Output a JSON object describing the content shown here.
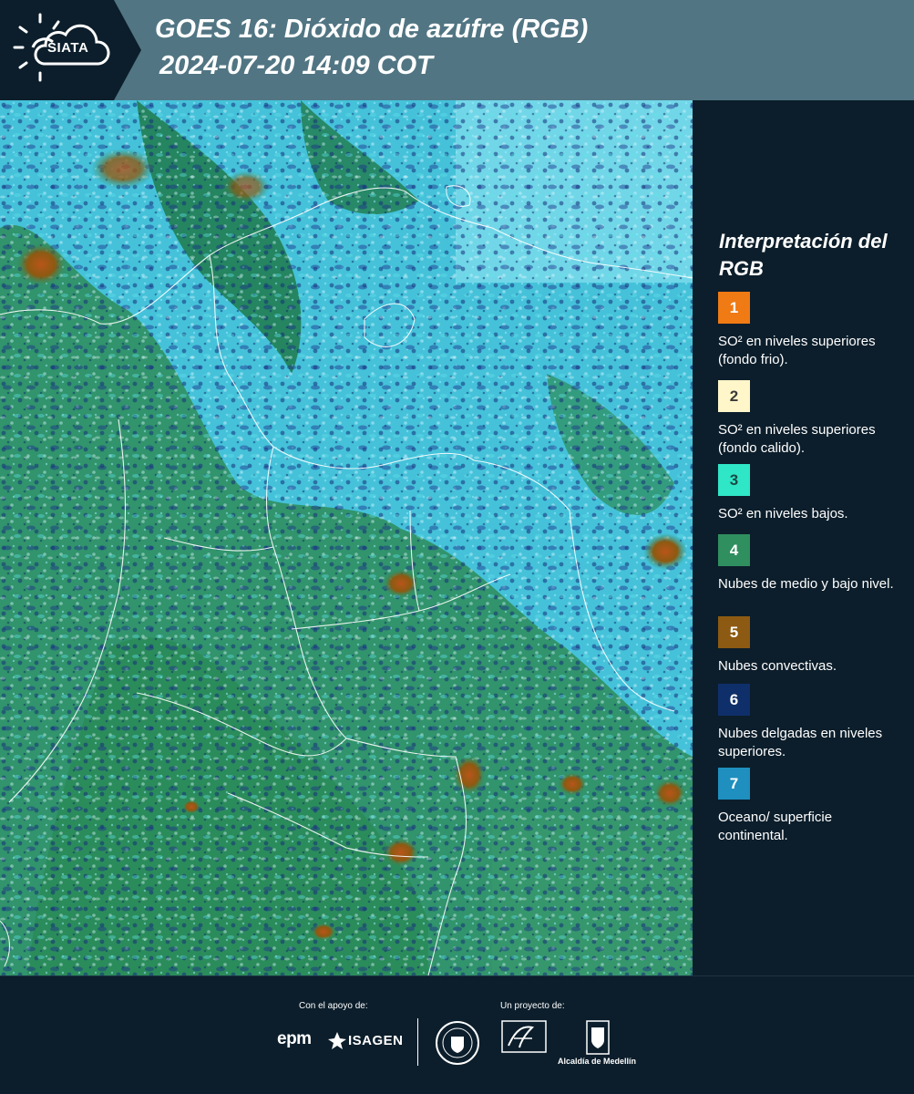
{
  "header": {
    "logo_text": "SIATA",
    "title": "GOES 16: Dióxido de azúfre (RGB)",
    "subtitle": "2024-07-20 14:09 COT"
  },
  "legend": {
    "title": "Interpretación del RGB",
    "items": [
      {
        "number": "1",
        "color": "#f07a14",
        "text": "SO² en niveles superiores (fondo frio)."
      },
      {
        "number": "2",
        "color": "#fff6c9",
        "text": "SO² en niveles superiores (fondo calido)."
      },
      {
        "number": "3",
        "color": "#2fe6c6",
        "text": "SO² en niveles bajos."
      },
      {
        "number": "4",
        "color": "#2f8f5f",
        "text": "Nubes de medio y bajo nivel."
      },
      {
        "number": "5",
        "color": "#8c5a12",
        "text": "Nubes convectivas."
      },
      {
        "number": "6",
        "color": "#0f2f6a",
        "text": "Nubes delgadas en niveles superiores."
      },
      {
        "number": "7",
        "color": "#1e8fbf",
        "text": "Oceano/ superficie continental."
      }
    ]
  },
  "footer": {
    "support_label": "Con el apoyo de:",
    "project_label": "Un proyecto de:",
    "sponsors": [
      "epm",
      "ISAGEN"
    ],
    "partners": [
      "Alcaldía de Medellín"
    ]
  },
  "colors": {
    "header_bg": "#517583",
    "page_bg": "#0c1e2b",
    "ocean": "#3fb9d6",
    "land": "#2f8f5f"
  }
}
